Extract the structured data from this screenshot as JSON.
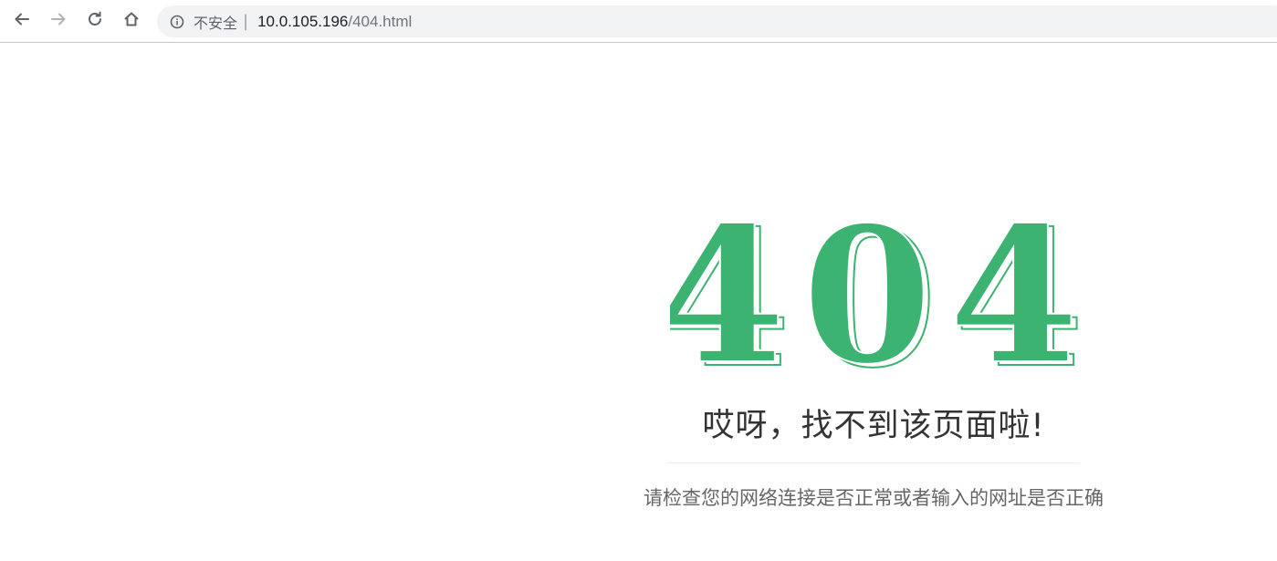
{
  "browser": {
    "security_label": "不安全",
    "url_separator": "|",
    "url_host": "10.0.105.196",
    "url_path": "/404.html",
    "icons": {
      "back": "arrow-left-icon",
      "forward": "arrow-right-icon",
      "reload": "reload-icon",
      "home": "home-icon",
      "security": "info-circle-icon"
    }
  },
  "page": {
    "error_code": "404",
    "headline": "哎呀，找不到该页面啦!",
    "hint": "请检查您的网络连接是否正常或者输入的网址是否正确"
  },
  "colors": {
    "accent": "#3cb371",
    "headline": "#333333",
    "hint": "#666666"
  }
}
